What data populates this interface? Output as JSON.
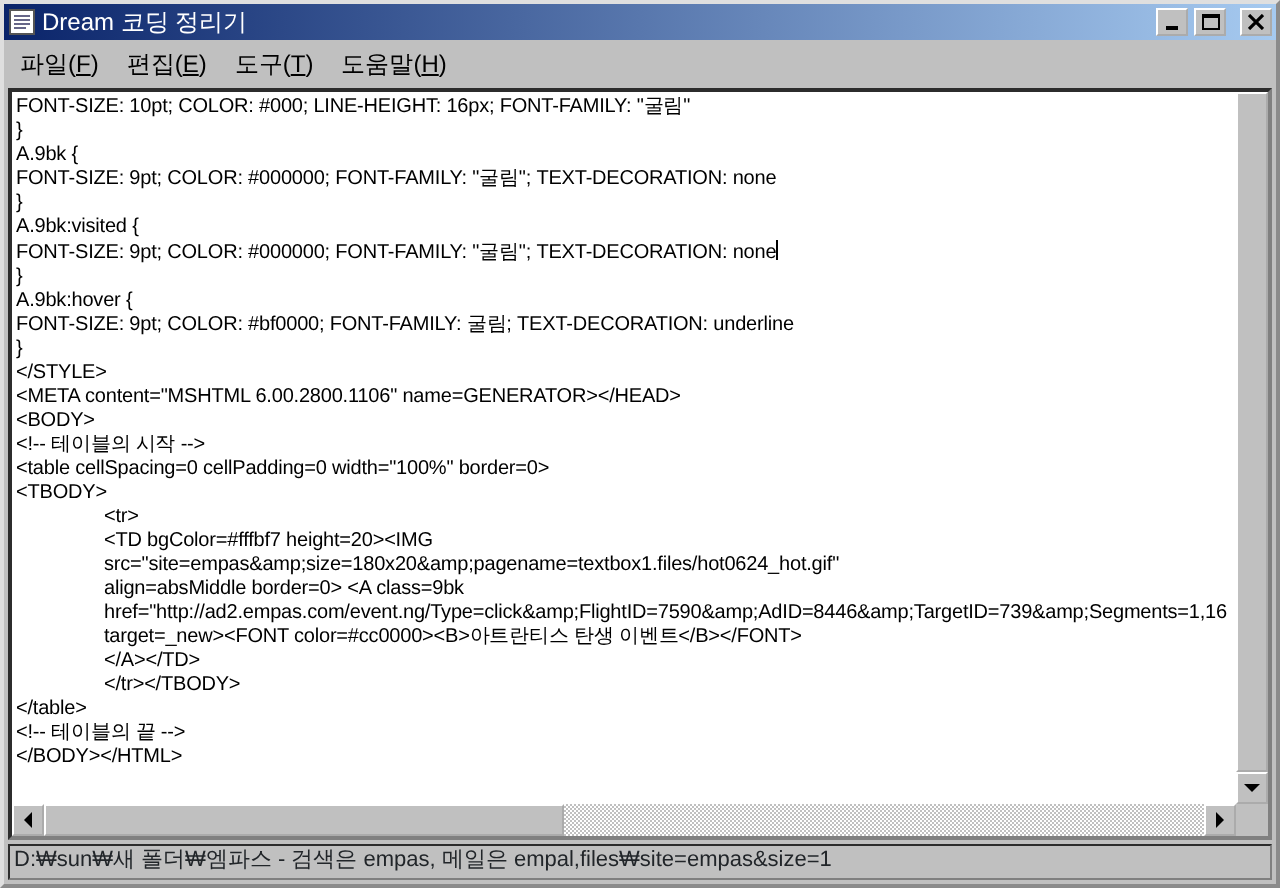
{
  "window": {
    "title": "Dream 코딩 정리기"
  },
  "menu": [
    {
      "label_before": "파일(",
      "mnemonic": "F",
      "label_after": ")"
    },
    {
      "label_before": "편집(",
      "mnemonic": "E",
      "label_after": ")"
    },
    {
      "label_before": "도구(",
      "mnemonic": "T",
      "label_after": ")"
    },
    {
      "label_before": "도움말(",
      "mnemonic": "H",
      "label_after": ")"
    }
  ],
  "editor": {
    "lines": [
      {
        "text": "FONT-SIZE: 10pt; COLOR: #000; LINE-HEIGHT: 16px; FONT-FAMILY: \"굴림\"",
        "kind": "plain",
        "cursor": false
      },
      {
        "text": "}",
        "kind": "plain",
        "cursor": false
      },
      {
        "text": "A.9bk {",
        "kind": "plain",
        "cursor": false
      },
      {
        "text": "FONT-SIZE: 9pt; COLOR: #000000; FONT-FAMILY: \"굴림\"; TEXT-DECORATION: none",
        "kind": "plain",
        "cursor": false
      },
      {
        "text": "}",
        "kind": "plain",
        "cursor": false
      },
      {
        "text": "A.9bk:visited {",
        "kind": "plain",
        "cursor": false
      },
      {
        "text": "FONT-SIZE: 9pt; COLOR: #000000; FONT-FAMILY: \"굴림\"; TEXT-DECORATION: none",
        "kind": "plain",
        "cursor": true
      },
      {
        "text": "}",
        "kind": "plain",
        "cursor": false
      },
      {
        "text": "A.9bk:hover {",
        "kind": "plain",
        "cursor": false
      },
      {
        "text": "FONT-SIZE: 9pt; COLOR: #bf0000; FONT-FAMILY: 굴림; TEXT-DECORATION: underline",
        "kind": "plain",
        "cursor": false
      },
      {
        "text": "}",
        "kind": "plain",
        "cursor": false
      },
      {
        "text": "</STYLE>",
        "kind": "plain",
        "cursor": false
      },
      {
        "text": "<META content=\"MSHTML 6.00.2800.1106\" name=GENERATOR></HEAD>",
        "kind": "plain",
        "cursor": false
      },
      {
        "text": "<BODY>",
        "kind": "plain",
        "cursor": false
      },
      {
        "text": "<!-- 테이블의 시작 -->",
        "kind": "plain",
        "cursor": false
      },
      {
        "text": "<table cellSpacing=0 cellPadding=0 width=\"100%\" border=0>",
        "kind": "plain",
        "cursor": false
      },
      {
        "text": "<TBODY>",
        "kind": "plain",
        "cursor": false
      },
      {
        "text": "<tr>",
        "kind": "indented",
        "cursor": false
      },
      {
        "text": "<TD bgColor=#fffbf7 height=20><IMG",
        "kind": "indented",
        "cursor": false
      },
      {
        "text": "src=\"site=empas&amp;size=180x20&amp;pagename=textbox1.files/hot0624_hot.gif\"",
        "kind": "indented",
        "cursor": false
      },
      {
        "text": "align=absMiddle border=0> <A class=9bk",
        "kind": "indented",
        "cursor": false
      },
      {
        "text": "href=\"http://ad2.empas.com/event.ng/Type=click&amp;FlightID=7590&amp;AdID=8446&amp;TargetID=739&amp;Segments=1,16",
        "kind": "indented",
        "cursor": false
      },
      {
        "text": "target=_new><FONT color=#cc0000><B>아트란티스 탄생 이벤트</B></FONT>",
        "kind": "indented",
        "cursor": false
      },
      {
        "text": "</A></TD>",
        "kind": "indented",
        "cursor": false
      },
      {
        "text": "</tr></TBODY>",
        "kind": "indented",
        "cursor": false
      },
      {
        "text": "</table>",
        "kind": "plain",
        "cursor": false
      },
      {
        "text": "<!-- 테이블의 끝 -->",
        "kind": "plain",
        "cursor": false
      },
      {
        "text": "</BODY></HTML>",
        "kind": "plain",
        "cursor": false
      }
    ]
  },
  "status_bar": {
    "text": "D:₩sun₩새 폴더₩엠파스 - 검색은 empas, 메일은 empal,files₩site=empas&size=1"
  }
}
